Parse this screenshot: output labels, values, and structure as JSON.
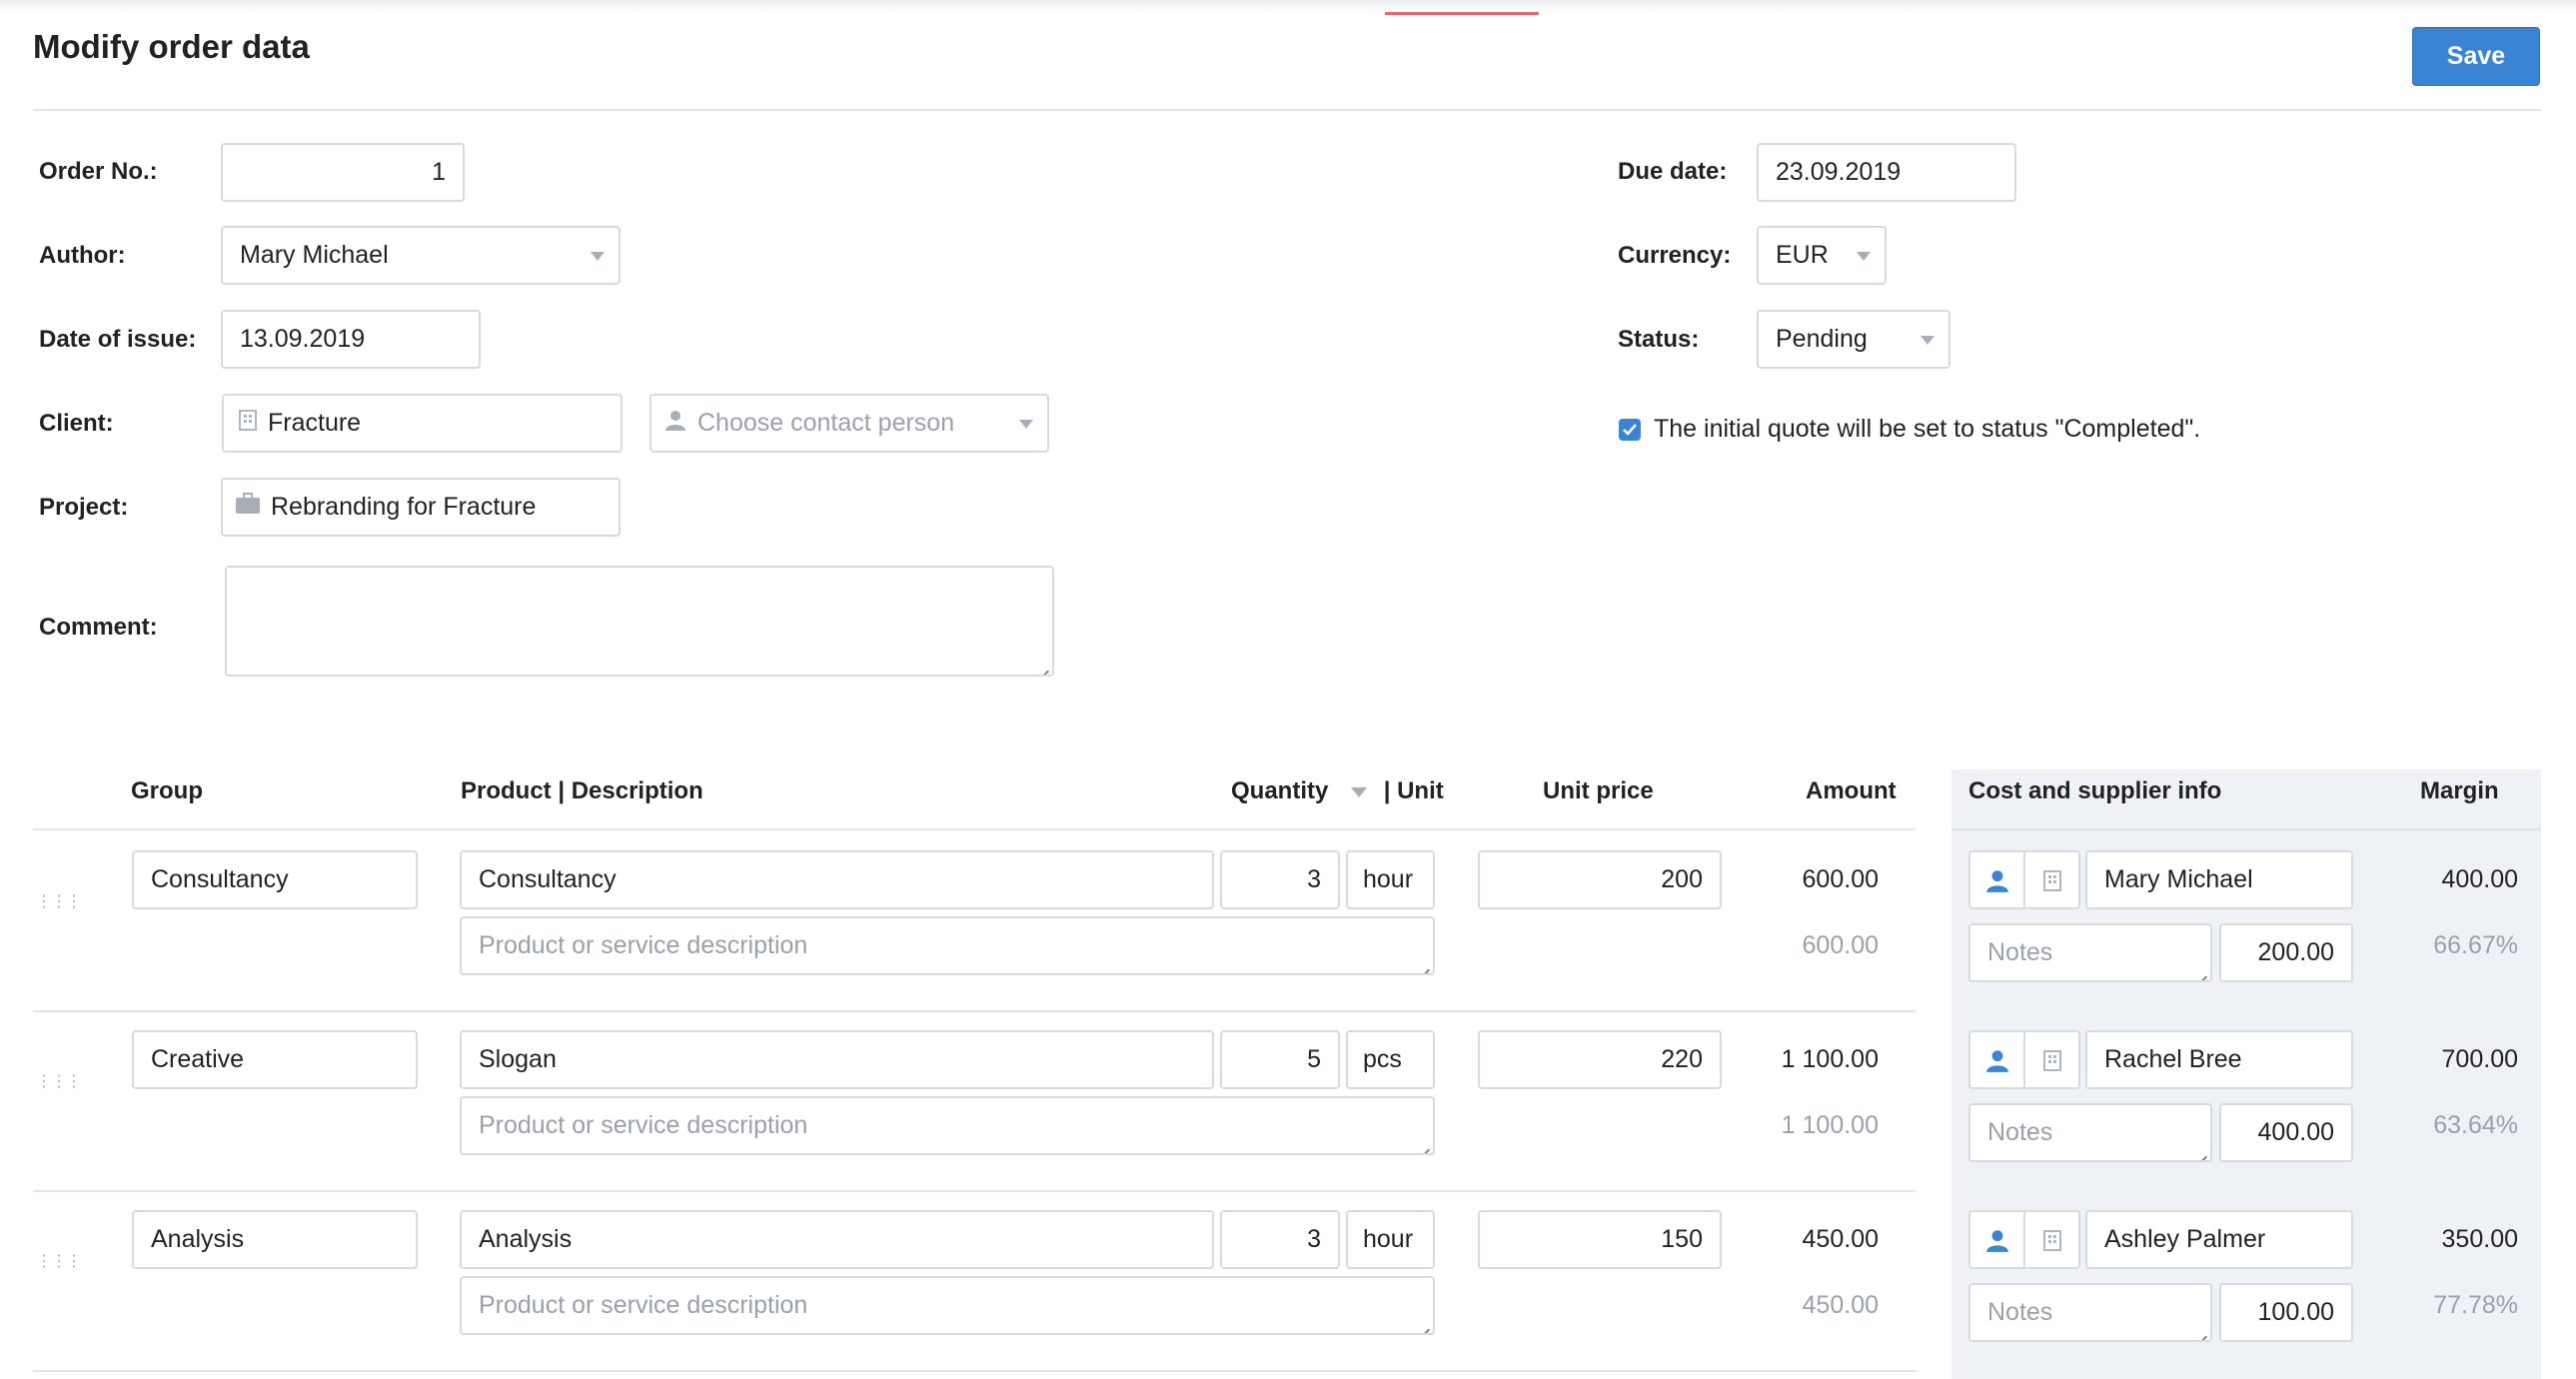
{
  "header": {
    "title": "Modify order data",
    "save_label": "Save"
  },
  "form": {
    "order_no": {
      "label": "Order No.:",
      "value": "1"
    },
    "author": {
      "label": "Author:",
      "value": "Mary Michael"
    },
    "date_of_issue": {
      "label": "Date of issue:",
      "value": "13.09.2019"
    },
    "client": {
      "label": "Client:",
      "value": "Fracture",
      "contact_placeholder": "Choose contact person"
    },
    "project": {
      "label": "Project:",
      "value": "Rebranding for Fracture"
    },
    "comment": {
      "label": "Comment:",
      "value": ""
    },
    "due_date": {
      "label": "Due date:",
      "value": "23.09.2019"
    },
    "currency": {
      "label": "Currency:",
      "value": "EUR"
    },
    "status": {
      "label": "Status:",
      "value": "Pending"
    },
    "initial_quote_note": "The initial quote will be set to status \"Completed\"."
  },
  "table": {
    "headers": {
      "group": "Group",
      "product": "Product | Description",
      "quantity": "Quantity",
      "unit": "| Unit",
      "unit_price": "Unit price",
      "amount": "Amount",
      "cost": "Cost and supplier info",
      "margin": "Margin"
    },
    "description_placeholder": "Product or service description",
    "notes_placeholder": "Notes",
    "rows": [
      {
        "group": "Consultancy",
        "product": "Consultancy",
        "quantity": "3",
        "unit": "hour",
        "unit_price": "200",
        "amount": "600.00",
        "amount_sub": "600.00",
        "supplier": "Mary Michael",
        "cost": "200.00",
        "margin": "400.00",
        "margin_pct": "66.67%"
      },
      {
        "group": "Creative",
        "product": "Slogan",
        "quantity": "5",
        "unit": "pcs",
        "unit_price": "220",
        "amount": "1 100.00",
        "amount_sub": "1 100.00",
        "supplier": "Rachel Bree",
        "cost": "400.00",
        "margin": "700.00",
        "margin_pct": "63.64%"
      },
      {
        "group": "Analysis",
        "product": "Analysis",
        "quantity": "3",
        "unit": "hour",
        "unit_price": "150",
        "amount": "450.00",
        "amount_sub": "450.00",
        "supplier": "Ashley Palmer",
        "cost": "100.00",
        "margin": "350.00",
        "margin_pct": "77.78%"
      }
    ]
  },
  "colors": {
    "accent": "#3b84d4",
    "border": "#d7dbe0",
    "muted_text": "#9aa1aa",
    "cost_panel": "#eef1f6"
  },
  "icons": [
    "building-icon",
    "person-icon",
    "briefcase-icon",
    "caret-down-icon",
    "checkbox-checked-icon",
    "drag-handle-icon",
    "resize-handle-icon"
  ]
}
